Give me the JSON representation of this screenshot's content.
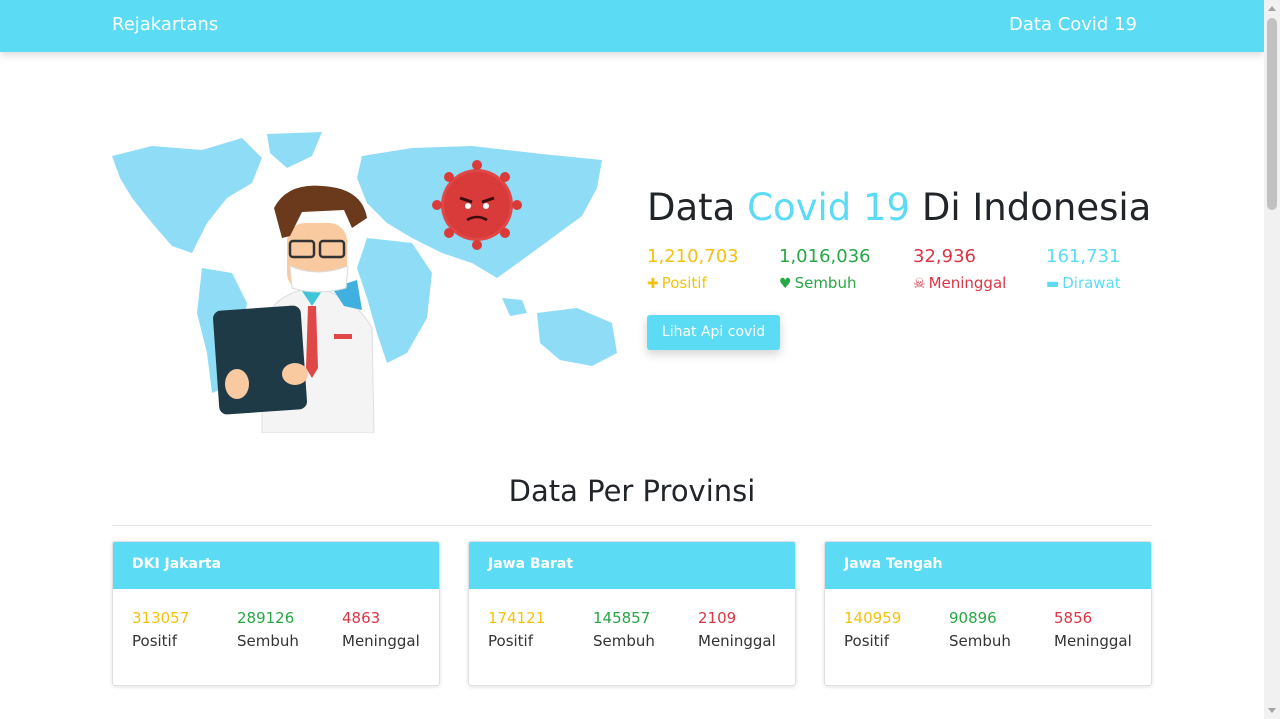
{
  "nav": {
    "brand": "Rejakartans",
    "link": "Data Covid 19"
  },
  "hero": {
    "title_pre": "Data ",
    "title_accent": "Covid 19",
    "title_post": " Di Indonesia",
    "stats": [
      {
        "value": "1,210,703",
        "label": "Positif",
        "icon": "plus-icon"
      },
      {
        "value": "1,016,036",
        "label": "Sembuh",
        "icon": "heart-pulse-icon"
      },
      {
        "value": "32,936",
        "label": "Meninggal",
        "icon": "skull-crossbones-icon"
      },
      {
        "value": "161,731",
        "label": "Dirawat",
        "icon": "bed-icon"
      }
    ],
    "button": "Lihat Api covid"
  },
  "provinces": {
    "title": "Data Per Provinsi",
    "cards": [
      {
        "name": "DKI Jakarta",
        "positif": "313057",
        "sembuh": "289126",
        "meninggal": "4863"
      },
      {
        "name": "Jawa Barat",
        "positif": "174121",
        "sembuh": "145857",
        "meninggal": "2109"
      },
      {
        "name": "Jawa Tengah",
        "positif": "140959",
        "sembuh": "90896",
        "meninggal": "5856"
      }
    ],
    "labels": {
      "positif": "Positif",
      "sembuh": "Sembuh",
      "meninggal": "Meninggal"
    }
  },
  "colors": {
    "accent": "#5bdcf4",
    "positif": "#f4c20d",
    "sembuh": "#28a745",
    "meninggal": "#dc3545",
    "dirawat": "#5bdcf4"
  }
}
